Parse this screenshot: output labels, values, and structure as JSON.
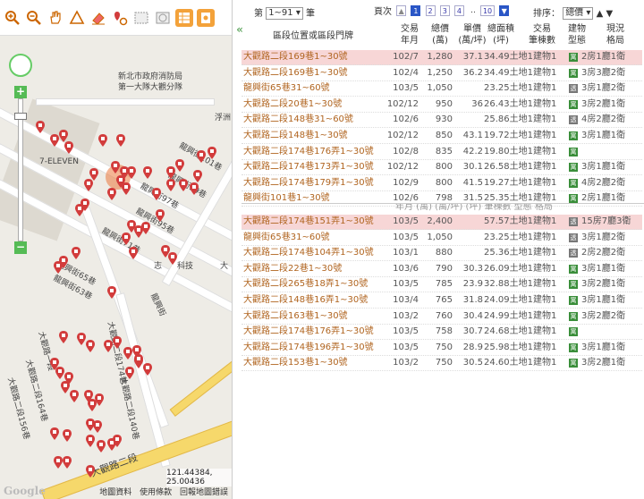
{
  "map": {
    "road_labels": [
      {
        "text": "新北市政府消防局",
        "name": "label-fire-dept"
      },
      {
        "text": "第一大隊大觀分隊",
        "name": "label-fire-branch"
      },
      {
        "text": "7-ELEVEN",
        "name": "label-seven-eleven"
      },
      {
        "text": "龍興街101巷",
        "name": "label-longxing-101"
      },
      {
        "text": "龍興街99巷",
        "name": "label-longxing-99"
      },
      {
        "text": "龍興街97巷",
        "name": "label-longxing-97"
      },
      {
        "text": "龍興街95巷",
        "name": "label-longxing-95"
      },
      {
        "text": "龍興街71巷",
        "name": "label-longxing-71"
      },
      {
        "text": "龍興街65巷",
        "name": "label-longxing-65"
      },
      {
        "text": "龍興街63巷",
        "name": "label-longxing-63"
      },
      {
        "text": "龍興街",
        "name": "label-longxing"
      },
      {
        "text": "浮洲",
        "name": "label-fuzhou"
      },
      {
        "text": "志",
        "name": "label-zhi"
      },
      {
        "text": "科技",
        "name": "label-tech"
      },
      {
        "text": "大",
        "name": "label-da"
      },
      {
        "text": "大觀路二段174巷",
        "name": "label-daguan-174"
      },
      {
        "text": "大觀路二段140巷",
        "name": "label-daguan-140"
      },
      {
        "text": "大觀路二段156巷",
        "name": "label-daguan-156"
      },
      {
        "text": "大觀路二段164巷",
        "name": "label-daguan-164"
      },
      {
        "text": "大觀路二段",
        "name": "label-daguan-main"
      },
      {
        "text": "大觀路一段",
        "name": "label-daguan-1"
      }
    ],
    "coords": "121.44384, 25.00436",
    "footer_links": [
      "地圖資料",
      "使用條款",
      "回報地圖錯誤"
    ],
    "logo": "Google"
  },
  "topbar": {
    "page_prefix": "第",
    "page_range": "1~91",
    "page_suffix": "筆",
    "page_label": "頁次",
    "pages": [
      "1",
      "2",
      "3",
      "4"
    ],
    "ellipsis": "..",
    "last_page": "10",
    "sort_label": "排序：",
    "sort_value": "總價",
    "sort_asc": "▲",
    "sort_desc": "▼"
  },
  "table": {
    "headers": {
      "address": "區段位置或區段門牌",
      "date_1": "交易",
      "date_2": "年月",
      "price_1": "總價",
      "price_2": "(萬)",
      "unit_1": "單價",
      "unit_2": "(萬/坪)",
      "area_1": "總面積",
      "area_2": "(坪)",
      "count_1": "交易",
      "count_2": "筆棟數",
      "type_1": "建物",
      "type_2": "型態",
      "layout_1": "現況",
      "layout_2": "格局"
    },
    "ghost_header": "年月    (萬)    (萬/坪)   (坪)      筆棟數    型態     格局",
    "group1": [
      {
        "address": "大觀路二段169巷1~30號",
        "date": "102/7",
        "price": "1,280",
        "unit": "37.1",
        "area": "34.49土地1建物1",
        "tag": "寓",
        "layout": "2房1廳1衛",
        "highlight": true
      },
      {
        "address": "大觀路二段169巷1~30號",
        "date": "102/4",
        "price": "1,250",
        "unit": "36.2",
        "area": "34.49土地1建物1",
        "tag": "寓",
        "layout": "3房3廳2衛",
        "highlight": false
      },
      {
        "address": "龍興街65巷31~60號",
        "date": "103/5",
        "price": "1,050",
        "unit": "",
        "area": "23.25土地1建物1",
        "tag": "透",
        "layout": "3房1廳2衛",
        "highlight": false
      },
      {
        "address": "大觀路二段20巷1~30號",
        "date": "102/12",
        "price": "950",
        "unit": "36",
        "area": "26.43土地1建物1",
        "tag": "寓",
        "layout": "3房2廳1衛",
        "highlight": false
      },
      {
        "address": "大觀路二段148巷31~60號",
        "date": "102/6",
        "price": "930",
        "unit": "",
        "area": "25.86土地1建物1",
        "tag": "透",
        "layout": "4房2廳2衛",
        "highlight": false
      },
      {
        "address": "大觀路二段148巷1~30號",
        "date": "102/12",
        "price": "850",
        "unit": "43.1",
        "area": "19.72土地1建物1",
        "tag": "寓",
        "layout": "3房1廳1衛",
        "highlight": false
      },
      {
        "address": "大觀路二段174巷176弄1~30號",
        "date": "102/8",
        "price": "835",
        "unit": "42.2",
        "area": "19.80土地1建物1",
        "tag": "寓",
        "layout": "",
        "highlight": false
      },
      {
        "address": "大觀路二段174巷173弄1~30號",
        "date": "102/12",
        "price": "800",
        "unit": "30.1",
        "area": "26.58土地1建物1",
        "tag": "寓",
        "layout": "3房1廳1衛",
        "highlight": false
      },
      {
        "address": "大觀路二段174巷179弄1~30號",
        "date": "102/9",
        "price": "800",
        "unit": "41.5",
        "area": "19.27土地1建物1",
        "tag": "寓",
        "layout": "4房2廳2衛",
        "highlight": false
      },
      {
        "address": "龍興街101巷1~30號",
        "date": "102/6",
        "price": "798",
        "unit": "31.5",
        "area": "25.35土地1建物1",
        "tag": "寓",
        "layout": "2房1廳1衛",
        "highlight": false
      }
    ],
    "group2": [
      {
        "address": "大觀路二段174巷151弄1~30號",
        "date": "103/5",
        "price": "2,400",
        "unit": "",
        "area": "57.57土地1建物1",
        "tag": "透",
        "layout": "15房7廳3衛",
        "highlight": true
      },
      {
        "address": "龍興街65巷31~60號",
        "date": "103/5",
        "price": "1,050",
        "unit": "",
        "area": "23.25土地1建物1",
        "tag": "透",
        "layout": "3房1廳2衛",
        "highlight": false
      },
      {
        "address": "大觀路二段174巷104弄1~30號",
        "date": "103/1",
        "price": "880",
        "unit": "",
        "area": "25.36土地1建物1",
        "tag": "透",
        "layout": "2房2廳2衛",
        "highlight": false
      },
      {
        "address": "大觀路二段22巷1~30號",
        "date": "103/6",
        "price": "790",
        "unit": "30.3",
        "area": "26.09土地1建物1",
        "tag": "寓",
        "layout": "3房1廳1衛",
        "highlight": false
      },
      {
        "address": "大觀路二段265巷18弄1~30號",
        "date": "103/5",
        "price": "785",
        "unit": "23.9",
        "area": "32.88土地1建物1",
        "tag": "寓",
        "layout": "3房2廳1衛",
        "highlight": false
      },
      {
        "address": "大觀路二段148巷16弄1~30號",
        "date": "103/4",
        "price": "765",
        "unit": "31.8",
        "area": "24.09土地1建物1",
        "tag": "寓",
        "layout": "3房1廳1衛",
        "highlight": false
      },
      {
        "address": "大觀路二段163巷1~30號",
        "date": "103/2",
        "price": "760",
        "unit": "30.4",
        "area": "24.99土地1建物1",
        "tag": "寓",
        "layout": "3房2廳2衛",
        "highlight": false
      },
      {
        "address": "大觀路二段174巷176弄1~30號",
        "date": "103/5",
        "price": "758",
        "unit": "30.7",
        "area": "24.68土地1建物1",
        "tag": "寓",
        "layout": "",
        "highlight": false
      },
      {
        "address": "大觀路二段174巷196弄1~30號",
        "date": "103/5",
        "price": "750",
        "unit": "28.9",
        "area": "25.98土地1建物1",
        "tag": "寓",
        "layout": "3房1廳1衛",
        "highlight": false
      },
      {
        "address": "大觀路二段153巷1~30號",
        "date": "103/2",
        "price": "750",
        "unit": "30.5",
        "area": "24.60土地1建物1",
        "tag": "寓",
        "layout": "3房2廳1衛",
        "highlight": false
      }
    ]
  },
  "colors": {
    "link": "#b0641f",
    "highlight": "#f7d6d6",
    "tag_apartment": "#3a8e3a",
    "tag_house": "#777777",
    "marker": "#d23c3c",
    "accent": "#2a56c6"
  }
}
